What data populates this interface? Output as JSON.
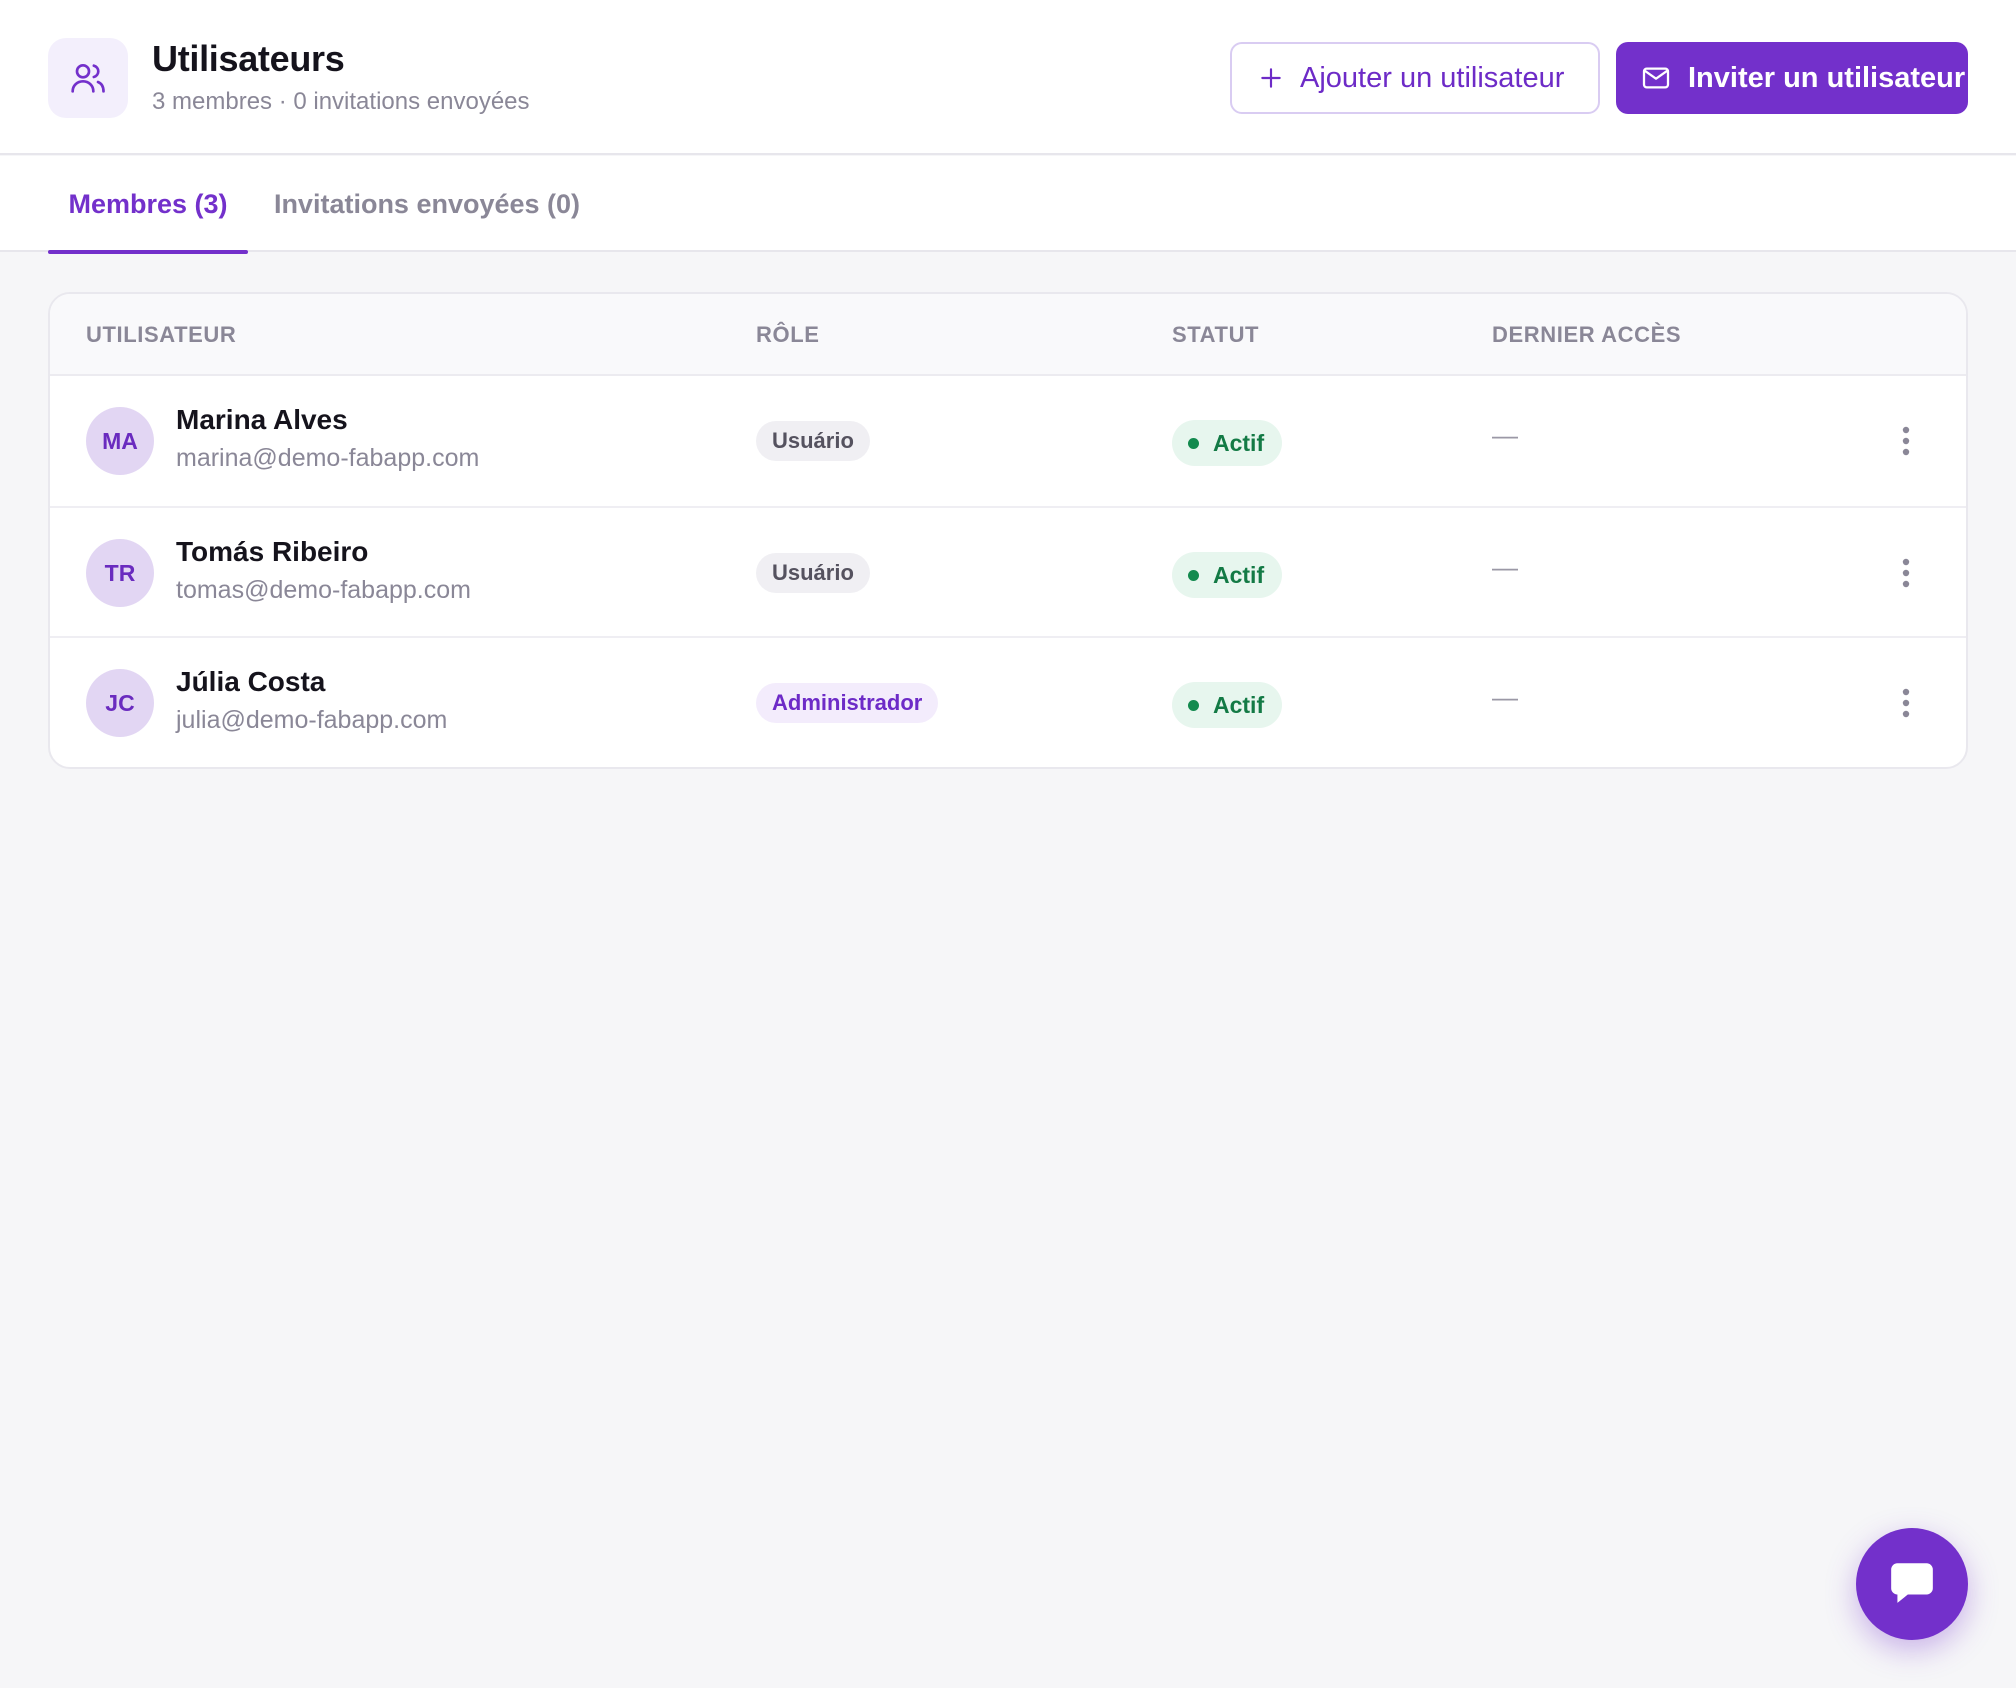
{
  "header": {
    "title": "Utilisateurs",
    "subtitle": "3 membres · 0 invitations envoyées",
    "icon": "users-icon",
    "add_button_label": "Ajouter un utilisateur",
    "invite_button_label": "Inviter un utilisateur"
  },
  "tabs": [
    {
      "label": "Membres (3)",
      "active": true
    },
    {
      "label": "Invitations envoyées (0)",
      "active": false
    }
  ],
  "table": {
    "columns": [
      "UTILISATEUR",
      "RÔLE",
      "STATUT",
      "DERNIER ACCÈS"
    ],
    "rows": [
      {
        "initials": "MA",
        "name": "Marina Alves",
        "email": "marina@demo-fabapp.com",
        "role": "Usuário",
        "status": "Actif",
        "last_access": "—"
      },
      {
        "initials": "TR",
        "name": "Tomás Ribeiro",
        "email": "tomas@demo-fabapp.com",
        "role": "Usuário",
        "status": "Actif",
        "last_access": "—"
      },
      {
        "initials": "JC",
        "name": "Júlia Costa",
        "email": "julia@demo-fabapp.com",
        "role": "Administrador",
        "status": "Actif",
        "last_access": "—"
      }
    ]
  },
  "colors": {
    "accent": "#7330cb",
    "status_active": "#137a45",
    "status_active_bg": "#e7f6ee"
  },
  "chat": {
    "icon": "chat-bubble-icon"
  }
}
